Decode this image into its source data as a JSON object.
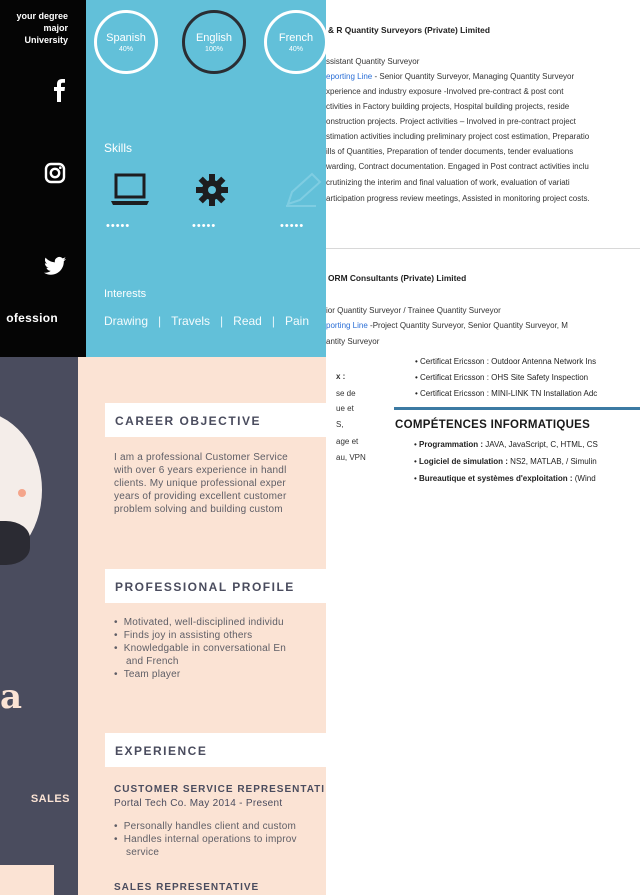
{
  "black_panel": {
    "education": [
      "your degree major",
      "University"
    ],
    "social_icons": [
      "facebook-icon",
      "instagram-icon",
      "twitter-icon"
    ],
    "profession": "ofession"
  },
  "blue_panel": {
    "languages": [
      {
        "name": "Spanish",
        "level": "40%"
      },
      {
        "name": "English",
        "level": "100%"
      },
      {
        "name": "French",
        "level": "40%"
      }
    ],
    "skills_title": "Skills",
    "skill_icons": [
      "laptop-icon",
      "gear-icon",
      "pen-icon"
    ],
    "skill_dots": "•••••",
    "interests_title": "Interests",
    "interests": [
      "Drawing",
      "Travels",
      "Read",
      "Pain"
    ]
  },
  "qs_panel": {
    "job1": {
      "company": "& R Quantity Surveyors (Private) Limited",
      "title": "ssistant Quantity Surveyor",
      "reporting_label": "eporting Line",
      "reporting_text": " - Senior Quantity Surveyor, Managing Quantity Surveyor",
      "lines": [
        "xperience  and  industry  exposure  -Involved  pre-contract  &  post  cont",
        "ctivities  in  Factory  building  projects,  Hospital  building  projects,  reside",
        "onstruction  projects.  Project  activities  –  Involved  in  pre-contract  project",
        "stimation activities including preliminary project cost estimation, Preparatio",
        "ills  of  Quantities,  Preparation  of  tender  documents,  tender  evaluations",
        "warding, Contract documentation. Engaged in Post contract activities inclu",
        "crutinizing  the  interim  and  final  valuation  of  work,  evaluation  of  variati",
        "articipation progress review meetings, Assisted in monitoring project costs."
      ]
    },
    "job2": {
      "company": "ORM Consultants (Private) Limited",
      "title": "ior Quantity Surveyor / Trainee Quantity Surveyor",
      "reporting_label": "porting Line",
      "reporting_text": " -Project  Quantity  Surveyor,  Senior  Quantity  Surveyor,  M",
      "line": "antity Surveyor"
    }
  },
  "french_panel": {
    "certs": [
      "• Certificat Ericsson : Outdoor Antenna Network Ins",
      "• Certificat Ericsson : OHS Site Safety Inspection",
      "• Certificat Ericsson : MINI-LINK TN Installation Adc"
    ],
    "fragments": [
      "x :",
      "se de",
      "ue et",
      "S,",
      "age et",
      "au, VPN"
    ],
    "competences_title": "COMPÉTENCES INFORMATIQUES",
    "competences": [
      {
        "label": "Programmation :",
        "value": " JAVA, JavaScript, C, HTML, CS"
      },
      {
        "label": "Logiciel de simulation :",
        "value": " NS2, MATLAB, / Simulin"
      },
      {
        "label": "Bureautique et systèmes d'exploitation :",
        "value": " (Wind"
      }
    ]
  },
  "cs_panel": {
    "initial": "a",
    "role": "SALES",
    "career_objective": {
      "title": "CAREER OBJECTIVE",
      "lines": [
        "I am a professional Customer Service",
        "with over 6 years experience in handl",
        "clients. My unique professional exper",
        "years of providing excellent customer",
        "problem solving and building custom"
      ]
    },
    "professional_profile": {
      "title": "PROFESSIONAL PROFILE",
      "items": [
        "Motivated, well-disciplined individu",
        "Finds joy in assisting others",
        "Knowledgable in conversational En",
        "and French",
        "Team player"
      ]
    },
    "experience": {
      "title": "EXPERIENCE",
      "job1_title": "CUSTOMER SERVICE REPRESENTATI",
      "job1_sub": "Portal Tech Co. May 2014 - Present",
      "job1_items": [
        "Personally handles client and custom",
        "Handles internal operations to improv",
        "service"
      ],
      "job2_title": "SALES REPRESENTATIVE"
    }
  }
}
